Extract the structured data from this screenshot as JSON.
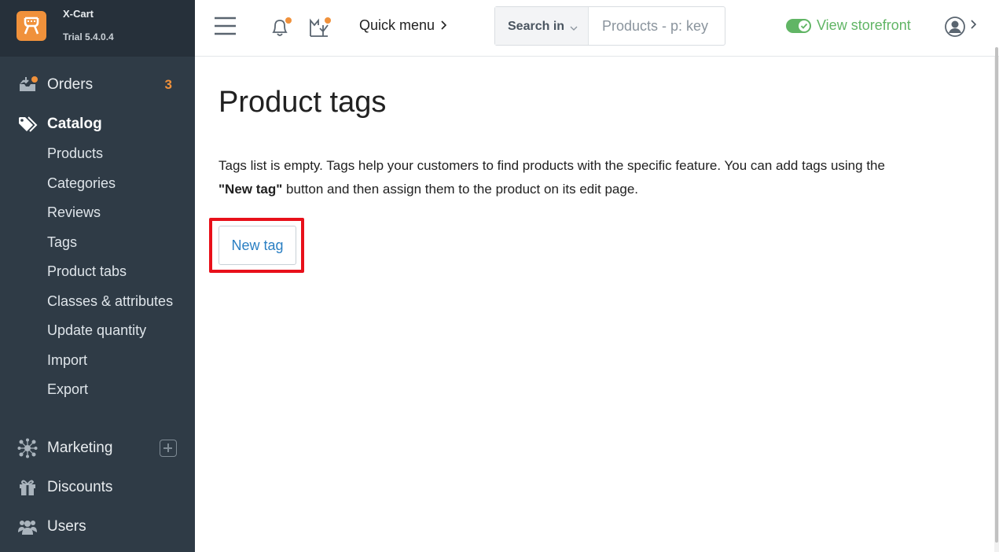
{
  "brand": {
    "name": "X-Cart",
    "version": "Trial 5.4.0.4",
    "accent": "#f0913b"
  },
  "sidebar": {
    "orders": {
      "label": "Orders",
      "count": "3",
      "icon": "inbox-icon"
    },
    "catalog": {
      "label": "Catalog",
      "icon": "tags-icon",
      "items": [
        "Products",
        "Categories",
        "Reviews",
        "Tags",
        "Product tabs",
        "Classes & attributes",
        "Update quantity",
        "Import",
        "Export"
      ]
    },
    "marketing": {
      "label": "Marketing",
      "icon": "network-icon"
    },
    "discounts": {
      "label": "Discounts",
      "icon": "gift-icon"
    },
    "users": {
      "label": "Users",
      "icon": "users-icon"
    }
  },
  "header": {
    "quick_menu": "Quick menu",
    "search": {
      "scope_label": "Search in",
      "placeholder": "Products - p: key"
    },
    "storefront": {
      "label": "View storefront",
      "enabled": true,
      "color": "#61b565"
    }
  },
  "main": {
    "title": "Product tags",
    "desc_part1": "Tags list is empty. Tags help your customers to find products with the specific feature. You can add tags using the",
    "desc_bold": "\"New tag\"",
    "desc_part2": "button and then assign them to the product on its edit page.",
    "new_tag_button": "New tag",
    "highlight_color": "#e8101a"
  }
}
